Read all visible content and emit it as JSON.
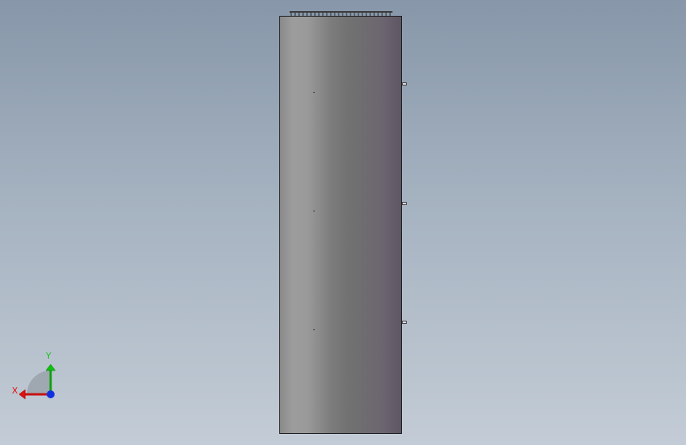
{
  "viewport": {
    "background_top": "#8797a9",
    "background_bottom": "#c3ccd6"
  },
  "model": {
    "shape": "cylinder",
    "mount_tabs": 3,
    "body_light": "#9c9c9c",
    "body_dark": "#5e5663"
  },
  "triad": {
    "x_label": "X",
    "y_label": "Y",
    "x_color": "#e01010",
    "y_color": "#10c010",
    "z_color": "#1030e0"
  }
}
